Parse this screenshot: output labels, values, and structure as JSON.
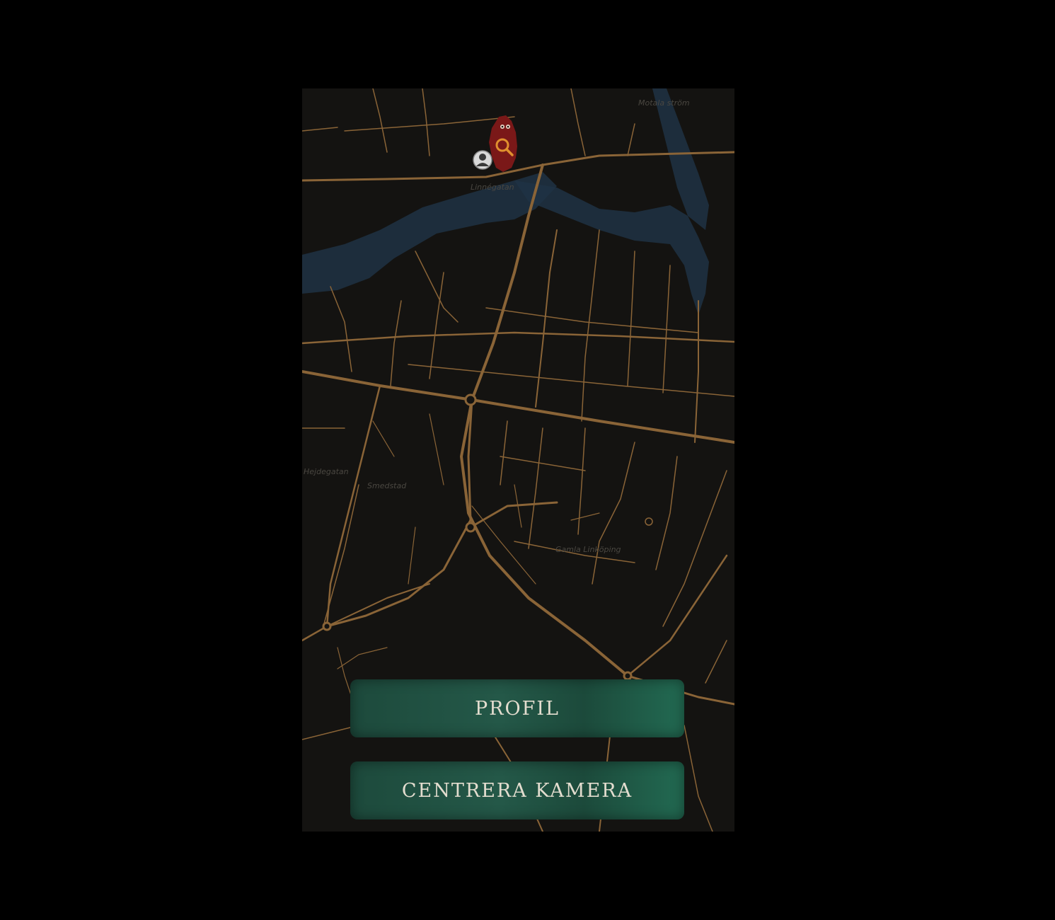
{
  "map": {
    "water_label": "Motala ström",
    "area_labels": [
      "Linnégatan",
      "Smedstad",
      "Gamla Linköping",
      "Hejdegatan"
    ]
  },
  "buttons": {
    "profile_label": "PROFIL",
    "center_camera_label": "CENTRERA KAMERA"
  },
  "markers": {
    "user_icon": "user-avatar-icon",
    "search_icon": "search-magnifier-icon"
  },
  "colors": {
    "background": "#000000",
    "map_base": "#141311",
    "roads": "#8a6437",
    "water": "#1e3344",
    "marker_red": "#7a1818",
    "button_green": "#1f5443",
    "button_text": "#e3ddcf"
  }
}
